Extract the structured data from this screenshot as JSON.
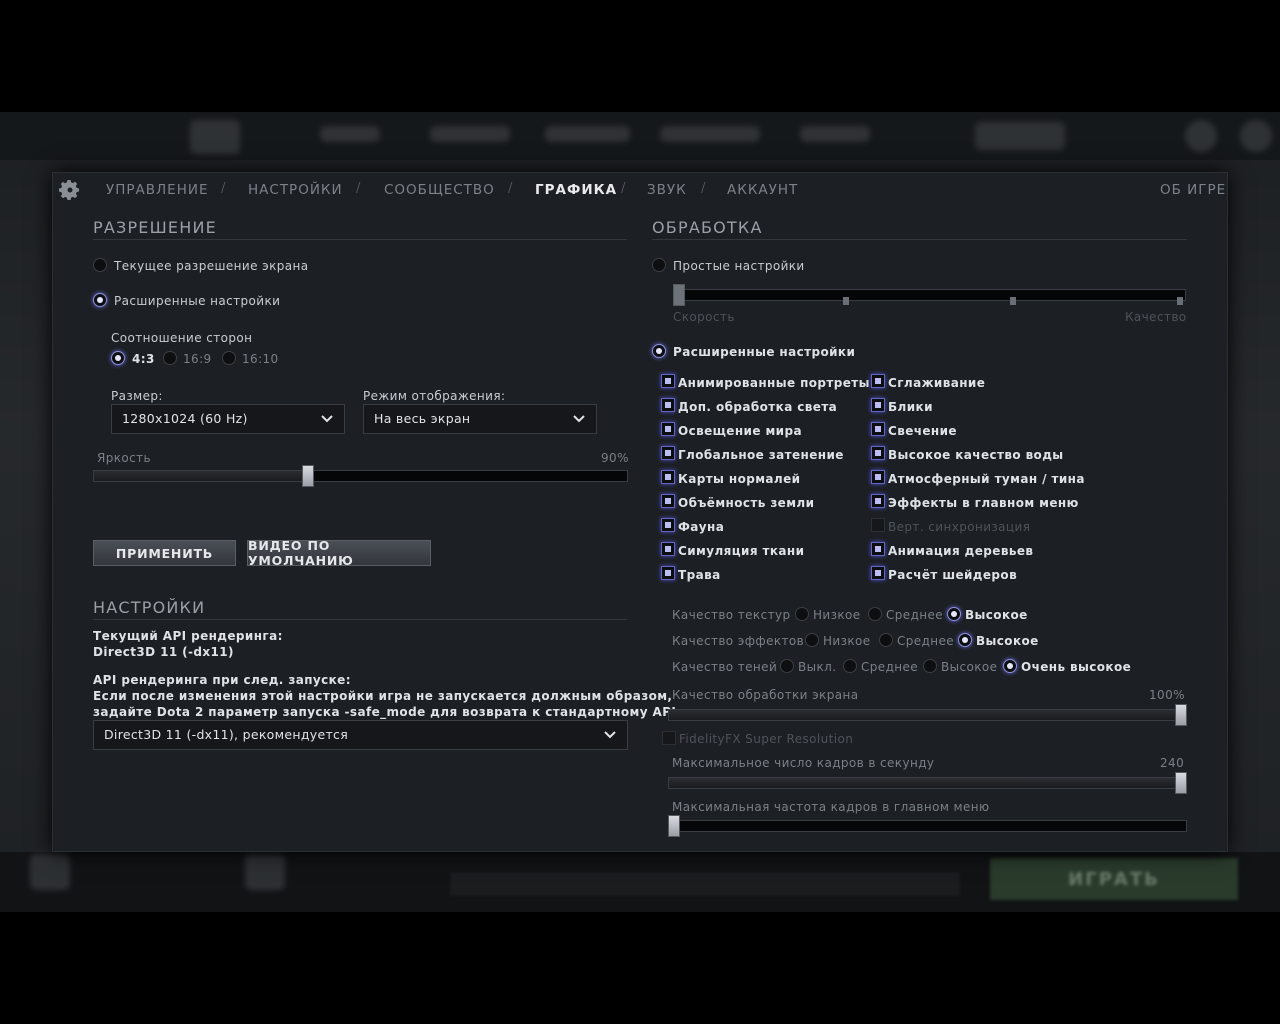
{
  "nav": {
    "items": [
      "УПРАВЛЕНИЕ",
      "НАСТРОЙКИ",
      "СООБЩЕСТВО",
      "ГРАФИКА",
      "ЗВУК",
      "АККАУНТ"
    ],
    "active": "ГРАФИКА",
    "about": "ОБ ИГРЕ"
  },
  "resolution": {
    "title": "РАЗРЕШЕНИЕ",
    "current_label": "Текущее разрешение экрана",
    "advanced_label": "Расширенные настройки",
    "mode_selected": "advanced",
    "aspect_label": "Соотношение сторон",
    "aspect_options": [
      "4:3",
      "16:9",
      "16:10"
    ],
    "aspect_selected": "4:3",
    "size_label": "Размер:",
    "size_value": "1280x1024 (60 Hz)",
    "display_mode_label": "Режим отображения:",
    "display_mode_value": "На весь экран",
    "brightness_label": "Яркость",
    "brightness_value_text": "90%",
    "brightness_fraction": 0.4,
    "apply_button": "ПРИМЕНИТЬ",
    "defaults_button": "ВИДЕО ПО УМОЛЧАНИЮ"
  },
  "settings": {
    "title": "НАСТРОЙКИ",
    "current_api_label": "Текущий API рендеринга:",
    "current_api_value": "Direct3D 11 (-dx11)",
    "next_api_label": "API рендеринга при след. запуске:",
    "next_api_note_1": "Если после изменения этой настройки игра не запускается должным образом,",
    "next_api_note_2": "задайте Dota 2 параметр запуска -safe_mode для возврата к стандартному API.",
    "next_api_value": "Direct3D 11 (-dx11), рекомендуется"
  },
  "processing": {
    "title": "ОБРАБОТКА",
    "simple_label": "Простые настройки",
    "speed_label": "Скорость",
    "quality_label": "Качество",
    "advanced_label": "Расширенные настройки",
    "mode_selected": "advanced",
    "checks_left": [
      {
        "label": "Анимированные портреты",
        "checked": true
      },
      {
        "label": "Доп. обработка света",
        "checked": true
      },
      {
        "label": "Освещение мира",
        "checked": true
      },
      {
        "label": "Глобальное затенение",
        "checked": true
      },
      {
        "label": "Карты нормалей",
        "checked": true
      },
      {
        "label": "Объёмность земли",
        "checked": true
      },
      {
        "label": "Фауна",
        "checked": true
      },
      {
        "label": "Симуляция ткани",
        "checked": true
      },
      {
        "label": "Трава",
        "checked": true
      }
    ],
    "checks_right": [
      {
        "label": "Сглаживание",
        "checked": true
      },
      {
        "label": "Блики",
        "checked": true
      },
      {
        "label": "Свечение",
        "checked": true
      },
      {
        "label": "Высокое качество воды",
        "checked": true
      },
      {
        "label": "Атмосферный туман / тина",
        "checked": true
      },
      {
        "label": "Эффекты в главном меню",
        "checked": true
      },
      {
        "label": "Верт. синхронизация",
        "checked": false,
        "disabled": true
      },
      {
        "label": "Анимация деревьев",
        "checked": true
      },
      {
        "label": "Расчёт шейдеров",
        "checked": true
      }
    ],
    "texture_quality": {
      "label": "Качество текстур",
      "options": [
        "Низкое",
        "Среднее",
        "Высокое"
      ],
      "selected": "Высокое"
    },
    "effects_quality": {
      "label": "Качество эффектов",
      "options": [
        "Низкое",
        "Среднее",
        "Высокое"
      ],
      "selected": "Высокое"
    },
    "shadow_quality": {
      "label": "Качество теней",
      "options": [
        "Выкл.",
        "Среднее",
        "Высокое",
        "Очень высокое"
      ],
      "selected": "Очень высокое"
    },
    "screen_quality_label": "Качество обработки экрана",
    "screen_quality_value_text": "100%",
    "screen_quality_fraction": 1.0,
    "fsr_label": "FidelityFX Super Resolution",
    "max_fps_label": "Максимальное число кадров в секунду",
    "max_fps_value_text": "240",
    "max_fps_fraction": 1.0,
    "menu_fps_label": "Максимальная частота кадров в главном меню",
    "menu_fps_fraction": 0.0
  },
  "background": {
    "play_button": "ИГРАТЬ"
  }
}
